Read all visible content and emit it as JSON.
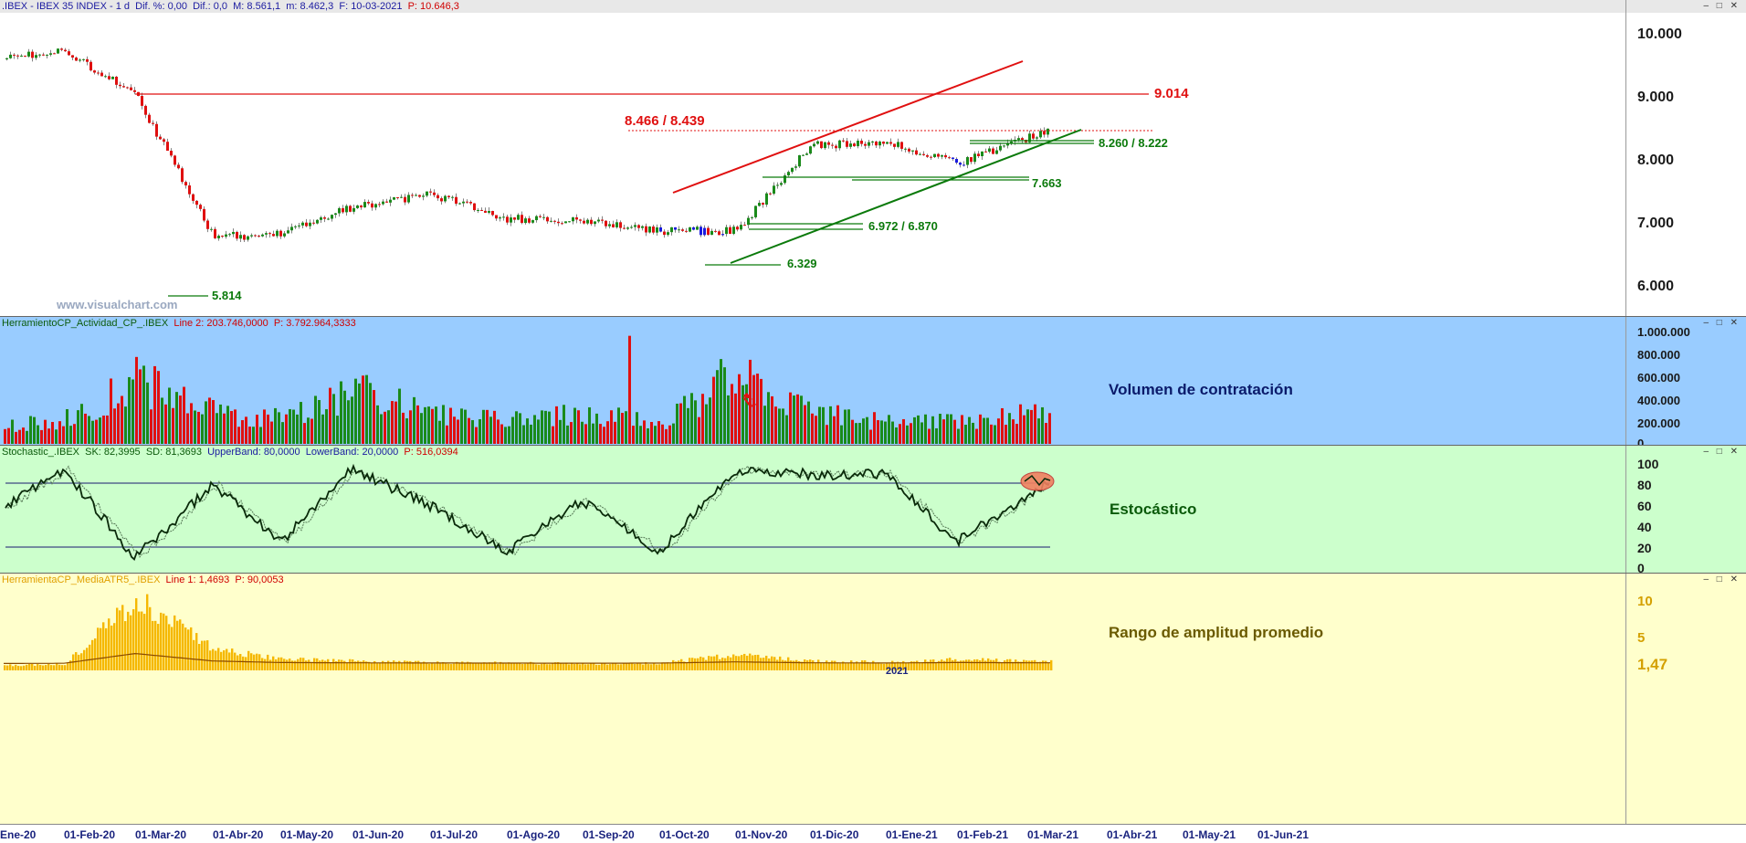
{
  "colors": {
    "price_bg": "#ffffff",
    "volume_bg": "#99ccff",
    "stoch_bg": "#ccffcc",
    "atr_bg": "#ffffcc",
    "bull_candle": "#1a8a1a",
    "bear_candle": "#e01010",
    "blue_candle": "#1a1ae0",
    "resistance": "#e01010",
    "support": "#0b7a0b",
    "atr_bar": "#f5b800"
  },
  "header": {
    "symbol": ".IBEX - IBEX 35 INDEX -  1 d",
    "dif_pct": "Dif. %: 0,00",
    "dif": "Dif.: 0,0",
    "min": "M: 8.561,1",
    "max": "m: 8.462,3",
    "date": "F: 10-03-2021",
    "price": "P: 10.646,3"
  },
  "window_controls": "– □ ✕",
  "price_panel": {
    "watermark": "www.visualchart.com",
    "y_ticks": [
      "10.000",
      "9.000",
      "8.000",
      "7.000",
      "6.000"
    ],
    "y_tick_values": [
      10000,
      9000,
      8000,
      7000,
      6000
    ],
    "labels": {
      "resistance_9014": "9.014",
      "range_8466": "8.466 / 8.439",
      "support_8260": "8.260 / 8.222",
      "support_7663": "7.663",
      "support_6972": "6.972 / 6.870",
      "support_6329": "6.329",
      "low_5814": "5.814"
    }
  },
  "volume_panel": {
    "header_name": "HerramientoCP_Actividad_CP_.IBEX",
    "header_line": "Line 2: 203.746,0000",
    "header_p": "P: 3.792.964,3333",
    "title": "Volumen de contratación",
    "y_ticks": [
      "1.000.000",
      "800.000",
      "600.000",
      "400.000",
      "200.000",
      "0"
    ]
  },
  "stoch_panel": {
    "header_name": "Stochastic_.IBEX",
    "header_sk": "SK: 82,3995",
    "header_sd": "SD: 81,3693",
    "header_upper": "UpperBand: 80,0000",
    "header_lower": "LowerBand: 20,0000",
    "header_p": "P: 516,0394",
    "title": "Estocástico",
    "y_ticks": [
      "100",
      "80",
      "60",
      "40",
      "20",
      "0"
    ]
  },
  "atr_panel": {
    "header_name": "HerramientaCP_MediaATR5_.IBEX",
    "header_line": "Line 1: 1,4693",
    "header_p": "P: 90,0053",
    "title": "Rango de amplitud promedio",
    "y_ticks": [
      "10",
      "5"
    ],
    "last_value": "1,47",
    "year_marker": "2021"
  },
  "date_axis": [
    "Ene-20",
    "01-Feb-20",
    "01-Mar-20",
    "01-Abr-20",
    "01-May-20",
    "01-Jun-20",
    "01-Jul-20",
    "01-Ago-20",
    "01-Sep-20",
    "01-Oct-20",
    "01-Nov-20",
    "01-Dic-20",
    "01-Ene-21",
    "01-Feb-21",
    "01-Mar-21",
    "01-Abr-21",
    "01-May-21",
    "01-Jun-21"
  ],
  "chart_data": [
    {
      "type": "line",
      "title": ".IBEX - IBEX 35 INDEX - 1 d",
      "xlabel": "",
      "ylabel": "",
      "ylim": [
        5500,
        10300
      ],
      "series": [
        {
          "name": "",
          "x": [
            "Ene-20",
            "01-Feb-20",
            "01-Mar-20",
            "01-Abr-20",
            "01-May-20",
            "01-Jun-20",
            "01-Jul-20",
            "01-Ago-20",
            "01-Sep-20",
            "01-Oct-20",
            "01-Nov-20",
            "01-Dic-20",
            "01-Ene-21",
            "01-Feb-21",
            "01-Mar-21"
          ],
          "values": [
            9600,
            9750,
            9000,
            6700,
            6750,
            7200,
            7400,
            7000,
            6950,
            6800,
            6800,
            8200,
            8250,
            7900,
            8450
          ]
        }
      ],
      "levels": [
        9014,
        8466,
        8439,
        8260,
        8222,
        7663,
        6972,
        6870,
        6329,
        5814
      ]
    },
    {
      "type": "bar",
      "title": "Volumen de contratación",
      "ylim": [
        0,
        1000000
      ],
      "categories": [
        "Ene-20",
        "01-Feb-20",
        "01-Mar-20",
        "01-Abr-20",
        "01-May-20",
        "01-Jun-20",
        "01-Jul-20",
        "01-Ago-20",
        "01-Sep-20",
        "01-Oct-20",
        "01-Nov-20",
        "01-Dic-20",
        "01-Ene-21",
        "01-Feb-21",
        "01-Mar-21"
      ],
      "values": [
        150000,
        200000,
        550000,
        260000,
        220000,
        450000,
        250000,
        200000,
        250000,
        180000,
        600000,
        280000,
        180000,
        200000,
        280000
      ]
    },
    {
      "type": "line",
      "title": "Estocástico",
      "ylim": [
        0,
        100
      ],
      "series": [
        {
          "name": "",
          "x": [
            "Ene-20",
            "01-Feb-20",
            "01-Mar-20",
            "01-Abr-20",
            "01-May-20",
            "01-Jun-20",
            "01-Jul-20",
            "01-Ago-20",
            "01-Sep-20",
            "01-Oct-20",
            "01-Nov-20",
            "01-Dic-20",
            "01-Ene-21",
            "01-Feb-21",
            "01-Mar-21"
          ],
          "values": [
            60,
            95,
            10,
            80,
            25,
            95,
            60,
            15,
            65,
            15,
            95,
            90,
            90,
            25,
            82
          ]
        }
      ],
      "bands": [
        80,
        20
      ]
    },
    {
      "type": "bar",
      "title": "Rango de amplitud promedio",
      "ylim": [
        0,
        13
      ],
      "categories": [
        "Ene-20",
        "01-Feb-20",
        "01-Mar-20",
        "01-Abr-20",
        "01-May-20",
        "01-Jun-20",
        "01-Jul-20",
        "01-Ago-20",
        "01-Sep-20",
        "01-Oct-20",
        "01-Nov-20",
        "01-Dic-20",
        "01-Ene-21",
        "01-Feb-21",
        "01-Mar-21"
      ],
      "values": [
        0.8,
        1.0,
        11.5,
        3.5,
        1.8,
        1.5,
        1.3,
        1.2,
        1.1,
        1.2,
        2.5,
        1.5,
        1.3,
        1.8,
        1.47
      ]
    }
  ]
}
